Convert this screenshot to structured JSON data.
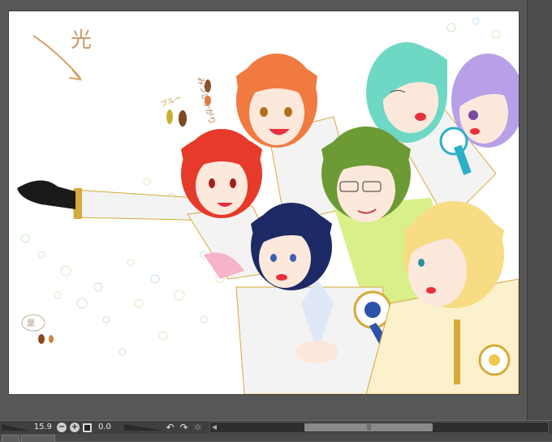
{
  "toolbar": {
    "zoom_value": "15.9",
    "rotation_value": "0.0",
    "zoom_out_glyph": "−",
    "zoom_in_glyph": "+",
    "rotate_left_glyph": "↶",
    "rotate_right_glyph": "↷",
    "reset_glyph": "✲",
    "scroll_left_glyph": "◀",
    "scroll_thumb_grip": "|||"
  },
  "artwork": {
    "notes": [
      "光",
      "みつきかがり",
      "ブルー",
      "葉"
    ],
    "palette": {
      "orange_hair": "#f07a40",
      "red_hair": "#e63a2a",
      "mint_hair": "#6fd8c4",
      "lavender_hair": "#b7a0e8",
      "green_hair": "#6c9a34",
      "navy_hair": "#1d2a66",
      "blonde_hair": "#f7dc84",
      "gold_trim": "#d6aa3a",
      "uniform": "#f3f3f3",
      "lime": "#d9f08a",
      "pink": "#f7b3c8",
      "blue_ribbon": "#2c53a8",
      "teal_ribbon": "#2ab0c8"
    }
  }
}
